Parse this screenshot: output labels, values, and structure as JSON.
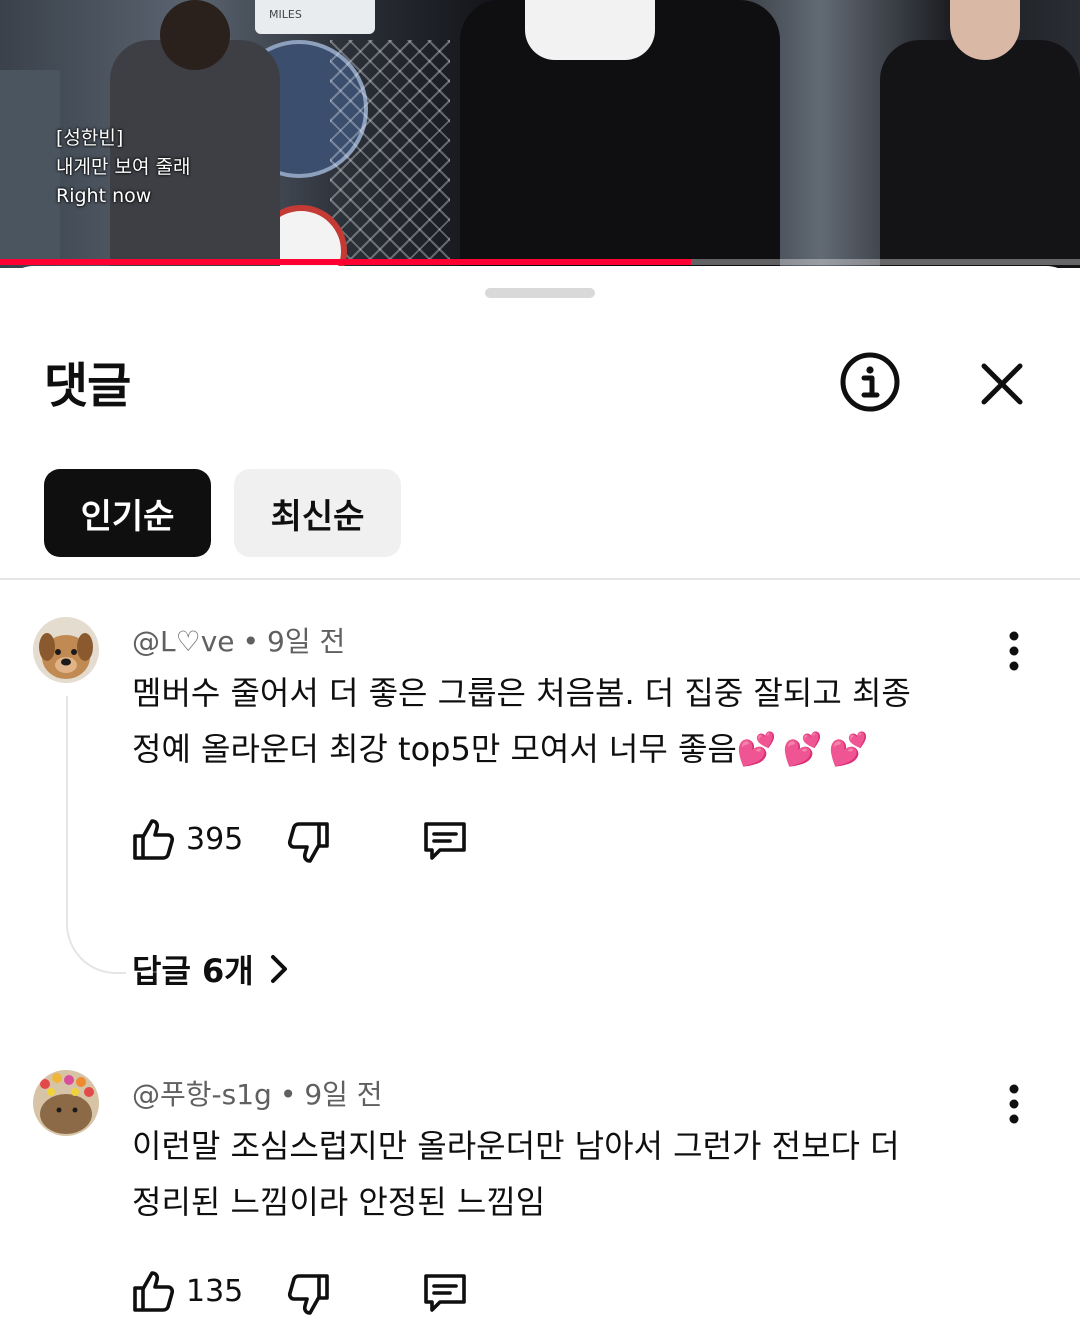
{
  "video": {
    "subtitle_lines": [
      "[성한빈]",
      "내게만 보여 줄래",
      "Right now"
    ],
    "sign_text": "MILES",
    "progress_percent": 64
  },
  "panel": {
    "title": "댓글",
    "info_icon": "info-icon",
    "close_icon": "close-icon"
  },
  "sort": {
    "popular": "인기순",
    "newest": "최신순"
  },
  "comments": [
    {
      "author": "@L♡ve",
      "time": "9일 전",
      "line1": "멤버수 줄어서 더 좋은 그룹은 처음봄. 더 집중 잘되고 최종",
      "line2": "정예 올라운더 최강 top5만 모여서 너무 좋음",
      "emoji": "💕💕💕",
      "likes": "395",
      "replies": "답글 6개"
    },
    {
      "author": "@푸항-s1g",
      "time": "9일 전",
      "line1": "이런말 조심스럽지만 올라운더만 남아서 그런가 전보다 더",
      "line2": "정리된 느낌이라 안정된 느낌임",
      "likes": "135"
    }
  ],
  "colors": {
    "accent": "#ff0033",
    "chip_active_bg": "#0f0f0f",
    "chip_idle_bg": "#f0f0f0",
    "meta_text": "#606060",
    "heart": "#e8389a"
  }
}
